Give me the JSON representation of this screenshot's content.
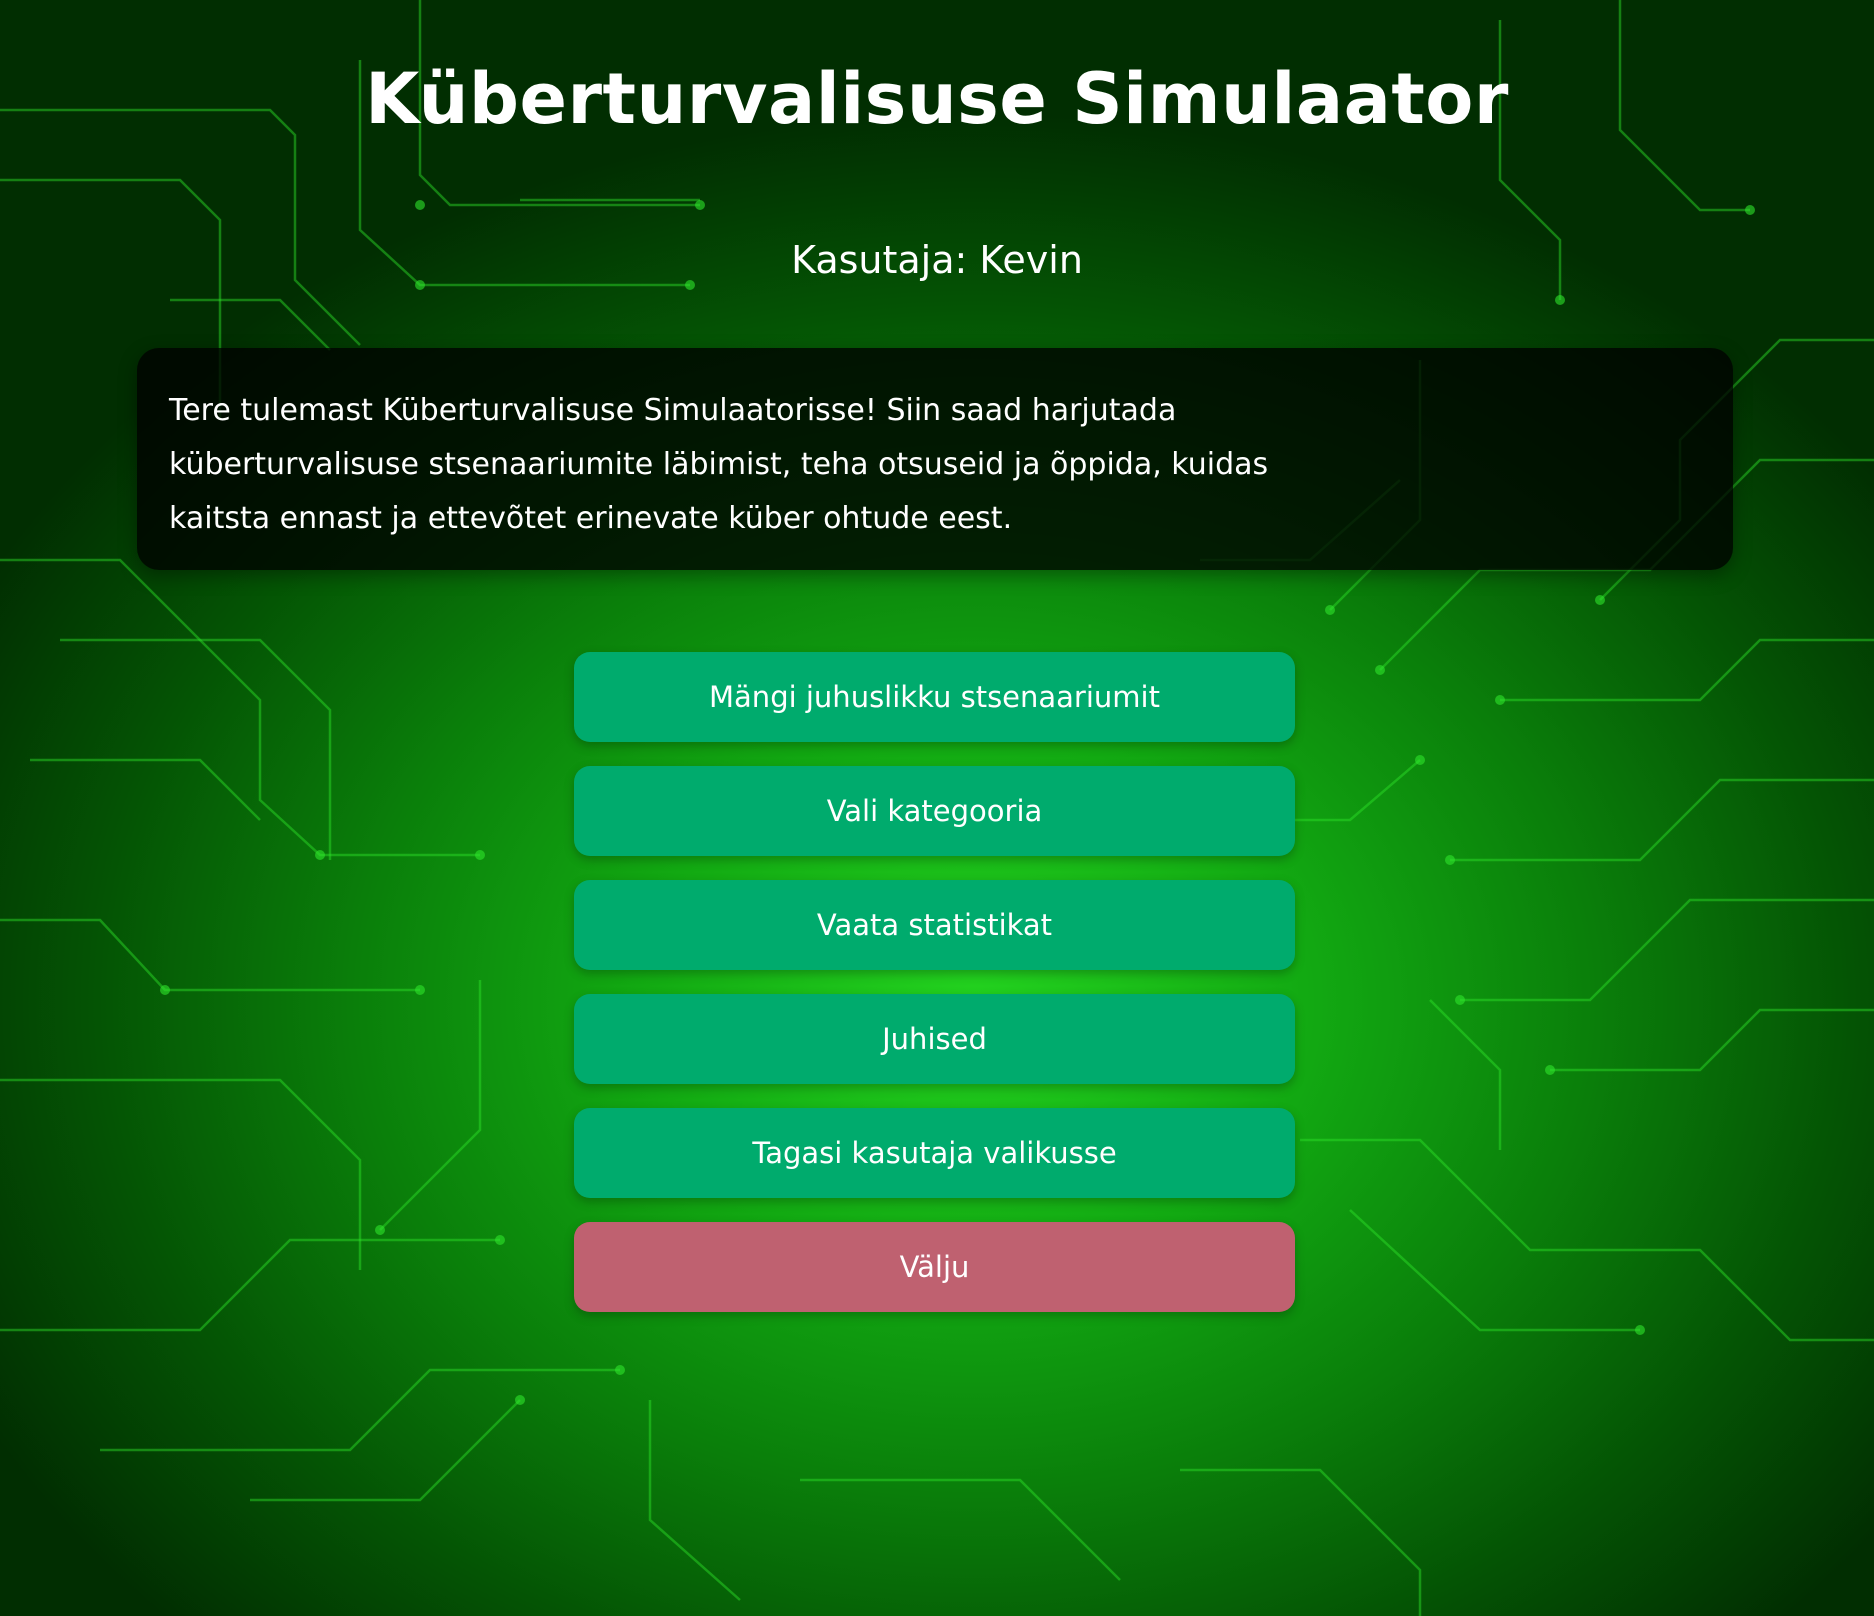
{
  "app": {
    "title": "Küberturvalisuse Simulaator",
    "user_label": "Kasutaja: Kevin",
    "welcome_text": "Tere tulemast Küberturvalisuse Simulaatorisse! Siin saad harjutada küberturvalisuse stsenaariumite läbimist, teha otsuseid ja õppida, kuidas kaitsta ennast ja ettevõtet erinevate küber ohtude eest."
  },
  "menu": {
    "random_scenario": "Mängi juhuslikku stsenaariumit",
    "choose_category": "Vali kategooria",
    "view_stats": "Vaata statistikat",
    "instructions": "Juhised",
    "back_to_user": "Tagasi kasutaja valikusse",
    "exit": "Välju"
  },
  "colors": {
    "primary_button": "#00ab6d",
    "exit_button": "#bf6170",
    "background_accent": "#23d21f"
  }
}
